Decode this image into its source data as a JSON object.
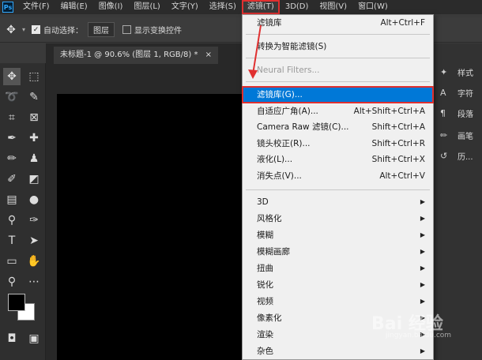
{
  "menubar": {
    "logo": "Ps",
    "items": [
      "文件(F)",
      "编辑(E)",
      "图像(I)",
      "图层(L)",
      "文字(Y)",
      "选择(S)",
      "滤镜(T)",
      "3D(D)",
      "视图(V)",
      "窗口(W)"
    ],
    "active_index": 6
  },
  "options": {
    "auto_select_label": "自动选择：",
    "auto_select_value": "图层",
    "transform_label": "显示变换控件"
  },
  "document": {
    "tab_title": "未标题-1 @ 90.6% (图层 1, RGB/8) *",
    "close": "×"
  },
  "right_panel": {
    "labels": [
      "样式",
      "字符",
      "段落",
      "画笔",
      "历..."
    ]
  },
  "filter_menu": {
    "last_filter": {
      "label": "滤镜库",
      "shortcut": "Alt+Ctrl+F"
    },
    "smart": {
      "label": "转换为智能滤镜(S)"
    },
    "neural": {
      "label": "Neural Filters..."
    },
    "gallery": {
      "label": "滤镜库(G)..."
    },
    "adaptive": {
      "label": "自适应广角(A)...",
      "shortcut": "Alt+Shift+Ctrl+A"
    },
    "camera_raw": {
      "label": "Camera Raw 滤镜(C)...",
      "shortcut": "Shift+Ctrl+A"
    },
    "lens": {
      "label": "镜头校正(R)...",
      "shortcut": "Shift+Ctrl+R"
    },
    "liquify": {
      "label": "液化(L)...",
      "shortcut": "Shift+Ctrl+X"
    },
    "vanish": {
      "label": "消失点(V)...",
      "shortcut": "Alt+Ctrl+V"
    },
    "submenus": [
      "3D",
      "风格化",
      "模糊",
      "模糊画廊",
      "扭曲",
      "锐化",
      "视频",
      "像素化",
      "渲染",
      "杂色"
    ]
  },
  "watermark": {
    "text": "Bai 经验",
    "sub": "jingyan.baidu.com"
  },
  "colors": {
    "highlight": "#0078d7",
    "annotation": "#e03030"
  }
}
